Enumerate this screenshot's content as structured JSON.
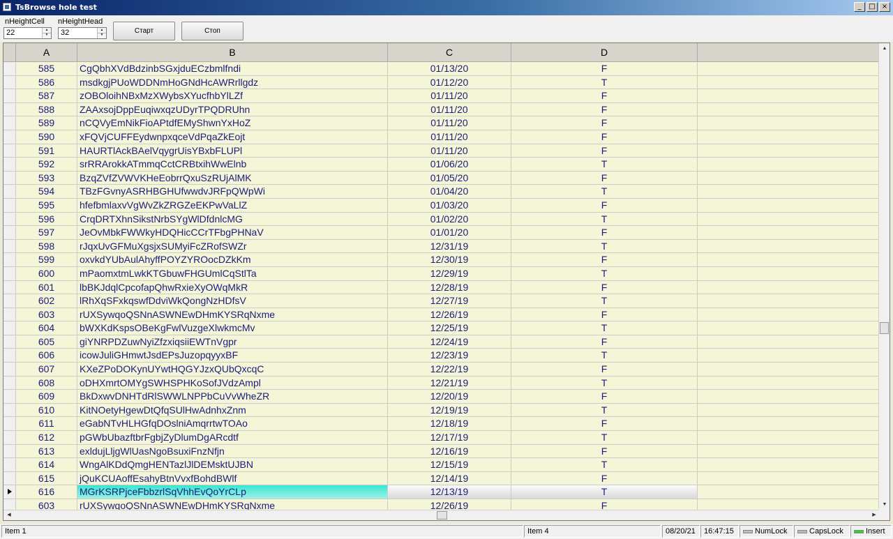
{
  "window": {
    "title": "TsBrowse hole test",
    "controls": [
      "_",
      "□",
      "×"
    ]
  },
  "toolbar": {
    "height_cell_label": "nHeightCell",
    "height_cell_value": "22",
    "height_head_label": "nHeightHead",
    "height_head_value": "32",
    "start_label": "Старт",
    "stop_label": "Стоп"
  },
  "grid": {
    "columns": [
      "A",
      "B",
      "C",
      "D"
    ],
    "rows": [
      {
        "a": "585",
        "b": "CgQbhXVdBdzinbSGxjduECzbmlfndi",
        "c": "01/13/20",
        "d": "F"
      },
      {
        "a": "586",
        "b": "msdkgjPUoWDDNmHoGNdHcAWRrllgdz",
        "c": "01/12/20",
        "d": "T"
      },
      {
        "a": "587",
        "b": "zOBOloihNBxMzXWybsXYucfhbYlLZf",
        "c": "01/11/20",
        "d": "F"
      },
      {
        "a": "588",
        "b": "ZAAxsojDppEuqiwxqzUDyrTPQDRUhn",
        "c": "01/11/20",
        "d": "F"
      },
      {
        "a": "589",
        "b": "nCQVyEmNikFioAPtdfEMyShwnYxHoZ",
        "c": "01/11/20",
        "d": "F"
      },
      {
        "a": "590",
        "b": "xFQVjCUFFEydwnpxqceVdPqaZkEojt",
        "c": "01/11/20",
        "d": "F"
      },
      {
        "a": "591",
        "b": "HAURTlAckBAelVqygrUisYBxbFLUPl",
        "c": "01/11/20",
        "d": "F"
      },
      {
        "a": "592",
        "b": "srRRArokkATmmqCctCRBtxihWwElnb",
        "c": "01/06/20",
        "d": "T"
      },
      {
        "a": "593",
        "b": "BzqZVfZVWVKHeEobrrQxuSzRUjAlMK",
        "c": "01/05/20",
        "d": "F"
      },
      {
        "a": "594",
        "b": "TBzFGvnyASRHBGHUfwwdvJRFpQWpWi",
        "c": "01/04/20",
        "d": "T"
      },
      {
        "a": "595",
        "b": "hfefbmlaxvVgWvZkZRGZeEKPwVaLlZ",
        "c": "01/03/20",
        "d": "F"
      },
      {
        "a": "596",
        "b": "CrqDRTXhnSikstNrbSYgWlDfdnlcMG",
        "c": "01/02/20",
        "d": "T"
      },
      {
        "a": "597",
        "b": "JeOvMbkFWWkyHDQHicCCrTFbgPHNaV",
        "c": "01/01/20",
        "d": "F"
      },
      {
        "a": "598",
        "b": "rJqxUvGFMuXgsjxSUMyiFcZRofSWZr",
        "c": "12/31/19",
        "d": "T"
      },
      {
        "a": "599",
        "b": "oxvkdYUbAulAhyffPOYZYROocDZkKm",
        "c": "12/30/19",
        "d": "F"
      },
      {
        "a": "600",
        "b": "mPaomxtmLwkKTGbuwFHGUmlCqStlTa",
        "c": "12/29/19",
        "d": "T"
      },
      {
        "a": "601",
        "b": "lbBKJdqlCpcofapQhwRxieXyOWqMkR",
        "c": "12/28/19",
        "d": "F"
      },
      {
        "a": "602",
        "b": "lRhXqSFxkqswfDdviWkQongNzHDfsV",
        "c": "12/27/19",
        "d": "T"
      },
      {
        "a": "603",
        "b": "rUXSywqoQSNnASWNEwDHmKYSRqNxme",
        "c": "12/26/19",
        "d": "F"
      },
      {
        "a": "604",
        "b": "bWXKdKspsOBeKgFwlVuzgeXlwkmcMv",
        "c": "12/25/19",
        "d": "T"
      },
      {
        "a": "605",
        "b": "giYNRPDZuwNyiZfzxiqsiiEWTnVgpr",
        "c": "12/24/19",
        "d": "F"
      },
      {
        "a": "606",
        "b": "icowJuliGHmwtJsdEPsJuzopqyyxBF",
        "c": "12/23/19",
        "d": "T"
      },
      {
        "a": "607",
        "b": "KXeZPoDOKynUYwtHQGYJzxQUbQxcqC",
        "c": "12/22/19",
        "d": "F"
      },
      {
        "a": "608",
        "b": "oDHXmrtOMYgSWHSPHKoSofJVdzAmpl",
        "c": "12/21/19",
        "d": "T"
      },
      {
        "a": "609",
        "b": "BkDxwvDNHTdRlSWWLNPPbCuVvWheZR",
        "c": "12/20/19",
        "d": "F"
      },
      {
        "a": "610",
        "b": "KitNOetyHgewDtQfqSUlHwAdnhxZnm",
        "c": "12/19/19",
        "d": "T"
      },
      {
        "a": "611",
        "b": "eGabNTvHLHGfqDOslniAmqrrtwTOAo",
        "c": "12/18/19",
        "d": "F"
      },
      {
        "a": "612",
        "b": "pGWbUbazftbrFgbjZyDlumDgARcdtf",
        "c": "12/17/19",
        "d": "T"
      },
      {
        "a": "613",
        "b": "exldujLljgWlUasNgoBsuxiFnzNfjn",
        "c": "12/16/19",
        "d": "F"
      },
      {
        "a": "614",
        "b": "WngAlKDdQmgHENTazlJlDEMsktUJBN",
        "c": "12/15/19",
        "d": "T"
      },
      {
        "a": "615",
        "b": "jQuKCUAoffEsahyBtnVvxfBohdBWlf",
        "c": "12/14/19",
        "d": "F"
      },
      {
        "a": "616",
        "b": "MGrKSRPjceFbbzrlSqVhhEvQoYrCLp",
        "c": "12/13/19",
        "d": "T",
        "current": true
      },
      {
        "a": "603",
        "b": "rUXSywqoQSNnASWNEwDHmKYSRqNxme",
        "c": "12/26/19",
        "d": "F"
      }
    ]
  },
  "status": {
    "item1": "Item 1",
    "item4": "Item 4",
    "date": "08/20/21",
    "time": "16:47:15",
    "numlock": "NumLock",
    "capslock": "CapsLock",
    "insert": "Insert"
  }
}
